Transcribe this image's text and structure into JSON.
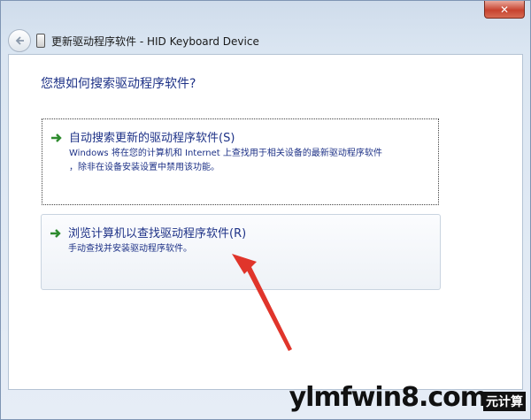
{
  "window": {
    "title": "更新驱动程序软件 - HID Keyboard Device",
    "close_glyph": "✕"
  },
  "content": {
    "question": "您想如何搜索驱动程序软件?",
    "options": [
      {
        "title": "自动搜索更新的驱动程序软件(S)",
        "desc_line1": "Windows 将在您的计算机和 Internet 上查找用于相关设备的最新驱动程序软件",
        "desc_line2": "，除非在设备安装设置中禁用该功能。"
      },
      {
        "title": "浏览计算机以查找驱动程序软件(R)",
        "desc_line1": "手动查找并安装驱动程序软件。"
      }
    ]
  },
  "watermark": {
    "main": "ylmfwin8.com",
    "sub": "元计算"
  },
  "colors": {
    "accent_text": "#1e3287",
    "arrow_green": "#2e8b2e",
    "annotation_red": "#e0352b"
  }
}
